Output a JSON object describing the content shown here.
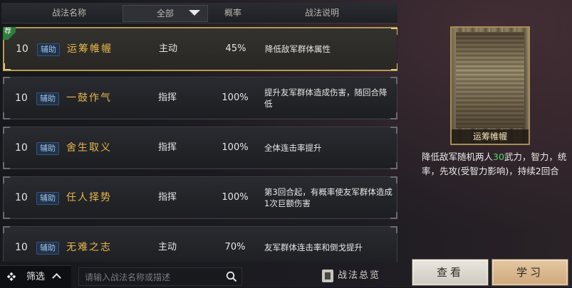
{
  "header": {
    "name_col": "战法名称",
    "filter_value": "全部",
    "prob_col": "概率",
    "desc_col": "战法说明"
  },
  "recommend_tag": "荐",
  "skills": [
    {
      "level": "10",
      "badge": "辅助",
      "name": "运筹帷幄",
      "type": "主动",
      "prob": "45%",
      "desc": "降低敌军群体属性",
      "selected": true
    },
    {
      "level": "10",
      "badge": "辅助",
      "name": "一鼓作气",
      "type": "指挥",
      "prob": "100%",
      "desc": "提升友军群体造成伤害，随回合降低"
    },
    {
      "level": "10",
      "badge": "辅助",
      "name": "舍生取义",
      "type": "指挥",
      "prob": "100%",
      "desc": "全体连击率提升"
    },
    {
      "level": "10",
      "badge": "辅助",
      "name": "任人择势",
      "type": "指挥",
      "prob": "100%",
      "desc": "第3回合起，有概率使友军群体造成1次巨额伤害"
    },
    {
      "level": "10",
      "badge": "辅助",
      "name": "无难之志",
      "type": "主动",
      "prob": "70%",
      "desc": "友军群体连击率和倒戈提升"
    }
  ],
  "bottom": {
    "filter_label": "筛选",
    "search_placeholder": "请输入战法名称或描述",
    "overview_label": "战法总览"
  },
  "detail": {
    "card_title": "运筹帷幄",
    "desc_before": "降低敌军随机两人",
    "desc_highlight": "30",
    "desc_after": "武力，智力，统率，先攻(受智力影响)，持续2回合",
    "highlight_color": "#4fd36d"
  },
  "buttons": {
    "view": "查看",
    "learn": "学习"
  }
}
